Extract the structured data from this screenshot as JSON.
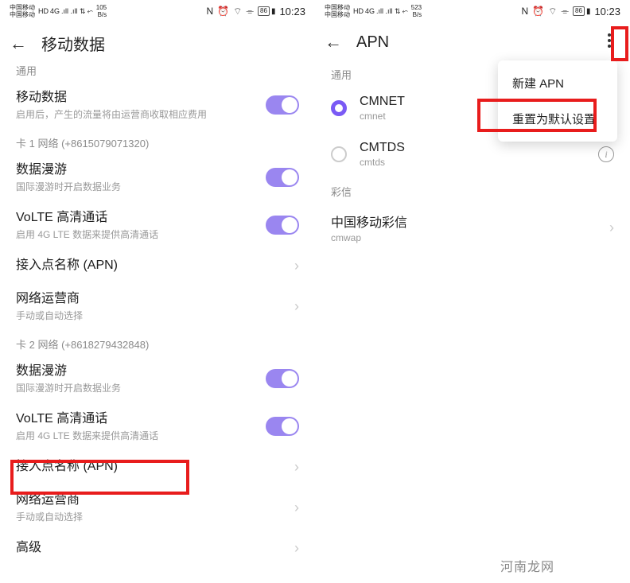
{
  "left": {
    "status": {
      "carrier1": "中国移动",
      "carrier2": "中国移动",
      "badge": "HD",
      "net": "4G",
      "signals": ".ıll .ıll ⇅",
      "wifi": "⬿",
      "speed_val": "105",
      "speed_unit": "B/s",
      "nfc": "N",
      "alarm": "⏰",
      "bt": "⌔",
      "dnd": "⌯",
      "battery": "86",
      "time": "10:23"
    },
    "header": {
      "title": "移动数据"
    },
    "cutoff": "通用",
    "mobile_data": {
      "title": "移动数据",
      "sub": "启用后，产生的流量将由运营商收取相应费用"
    },
    "sim1_label": "卡 1 网络 (+8615079071320)",
    "sim1": {
      "roaming": {
        "title": "数据漫游",
        "sub": "国际漫游时开启数据业务"
      },
      "volte": {
        "title": "VoLTE 高清通话",
        "sub": "启用 4G LTE 数据来提供高清通话"
      },
      "apn": {
        "title": "接入点名称 (APN)"
      },
      "carrier": {
        "title": "网络运营商",
        "sub": "手动或自动选择"
      }
    },
    "sim2_label": "卡 2 网络 (+8618279432848)",
    "sim2": {
      "roaming": {
        "title": "数据漫游",
        "sub": "国际漫游时开启数据业务"
      },
      "volte": {
        "title": "VoLTE 高清通话",
        "sub": "启用 4G LTE 数据来提供高清通话"
      },
      "apn": {
        "title": "接入点名称 (APN)"
      },
      "carrier": {
        "title": "网络运营商",
        "sub": "手动或自动选择"
      },
      "advanced": {
        "title": "高级"
      }
    }
  },
  "right": {
    "status": {
      "carrier1": "中国移动",
      "carrier2": "中国移动",
      "badge": "HD",
      "net": "4G",
      "signals": ".ıll .ıll ⇅",
      "wifi": "⬿",
      "speed_val": "523",
      "speed_unit": "B/s",
      "nfc": "N",
      "alarm": "⏰",
      "bt": "⌔",
      "dnd": "⌯",
      "battery": "86",
      "time": "10:23"
    },
    "header": {
      "title": "APN"
    },
    "section_general": "通用",
    "apn1": {
      "title": "CMNET",
      "sub": "cmnet"
    },
    "apn2": {
      "title": "CMTDS",
      "sub": "cmtds"
    },
    "section_mms": "彩信",
    "apn3": {
      "title": "中国移动彩信",
      "sub": "cmwap"
    },
    "popup": {
      "item1": "新建 APN",
      "item2": "重置为默认设置"
    }
  },
  "watermark": "河南龙网"
}
